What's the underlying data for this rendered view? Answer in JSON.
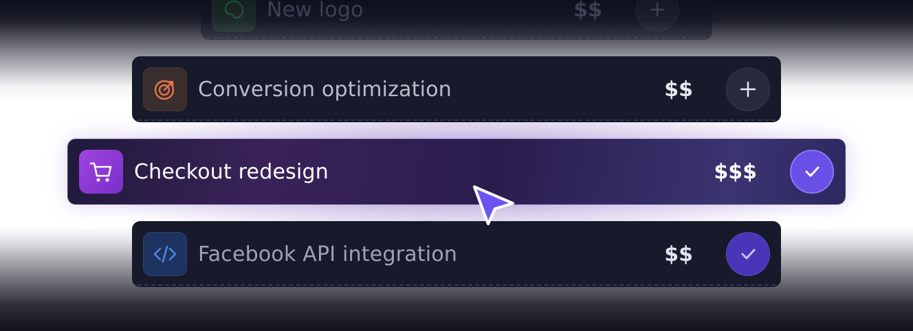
{
  "items": [
    {
      "label": "New logo",
      "price": "$$",
      "icon": "palette-icon",
      "action": "add",
      "icon_color": "#3c8a52"
    },
    {
      "label": "Conversion optimization",
      "price": "$$",
      "icon": "target-icon",
      "action": "add",
      "icon_color": "#e0744a"
    },
    {
      "label": "Checkout redesign",
      "price": "$$$",
      "icon": "shopping-cart-icon",
      "action": "selected",
      "icon_color": "#ffffff",
      "selected": true
    },
    {
      "label": "Facebook API integration",
      "price": "$$",
      "icon": "code-icon",
      "action": "selected",
      "icon_color": "#4f86e0"
    }
  ],
  "colors": {
    "accent": "#6a4fe8",
    "card_bg": "#171a2a"
  },
  "cursor": "pointer-cursor-icon"
}
